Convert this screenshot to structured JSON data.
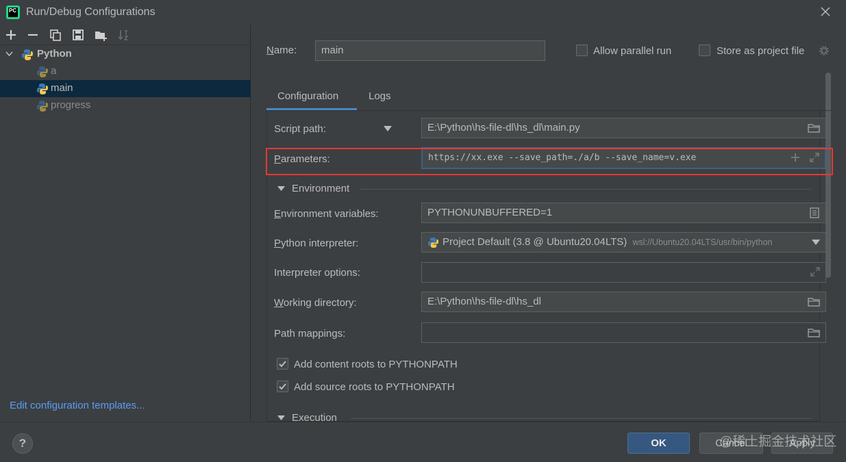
{
  "window": {
    "title": "Run/Debug Configurations",
    "app_icon_text": "PC"
  },
  "tree": {
    "root": "Python",
    "items": [
      {
        "label": "a"
      },
      {
        "label": "main",
        "selected": true
      },
      {
        "label": "progress"
      }
    ]
  },
  "left_footer": {
    "edit_templates": "Edit configuration templates..."
  },
  "header": {
    "name_label": "Name:",
    "name_value": "main",
    "allow_parallel_run": "Allow parallel run",
    "store_as_project_file": "Store as project file"
  },
  "tabs": [
    "Configuration",
    "Logs"
  ],
  "config": {
    "script_path_label": "Script path:",
    "script_path_value": "E:\\Python\\hs-file-dl\\hs_dl\\main.py",
    "parameters_label": "Parameters:",
    "parameters_value": "https://xx.exe  --save_path=./a/b --save_name=v.exe",
    "environment_section": "Environment",
    "env_vars_label": "Environment variables:",
    "env_vars_value": "PYTHONUNBUFFERED=1",
    "interpreter_label": "Python interpreter:",
    "interpreter_value": "Project Default (3.8 @ Ubuntu20.04LTS)",
    "interpreter_path": "wsl://Ubuntu20.04LTS/usr/bin/python",
    "interpreter_options_label": "Interpreter options:",
    "working_dir_label": "Working directory:",
    "working_dir_value": "E:\\Python\\hs-file-dl\\hs_dl",
    "path_mappings_label": "Path mappings:",
    "add_content_roots": "Add content roots to PYTHONPATH",
    "add_source_roots": "Add source roots to PYTHONPATH",
    "execution_section": "Execution"
  },
  "footer": {
    "help": "?",
    "ok": "OK",
    "cancel": "Cancel",
    "apply": "Apply",
    "watermark": "@稀土掘金技术社区"
  },
  "colors": {
    "background": "#3c3f41",
    "selection": "#0d293e",
    "accent": "#4a88c7",
    "link": "#589df6",
    "highlight_box": "#e53935"
  }
}
